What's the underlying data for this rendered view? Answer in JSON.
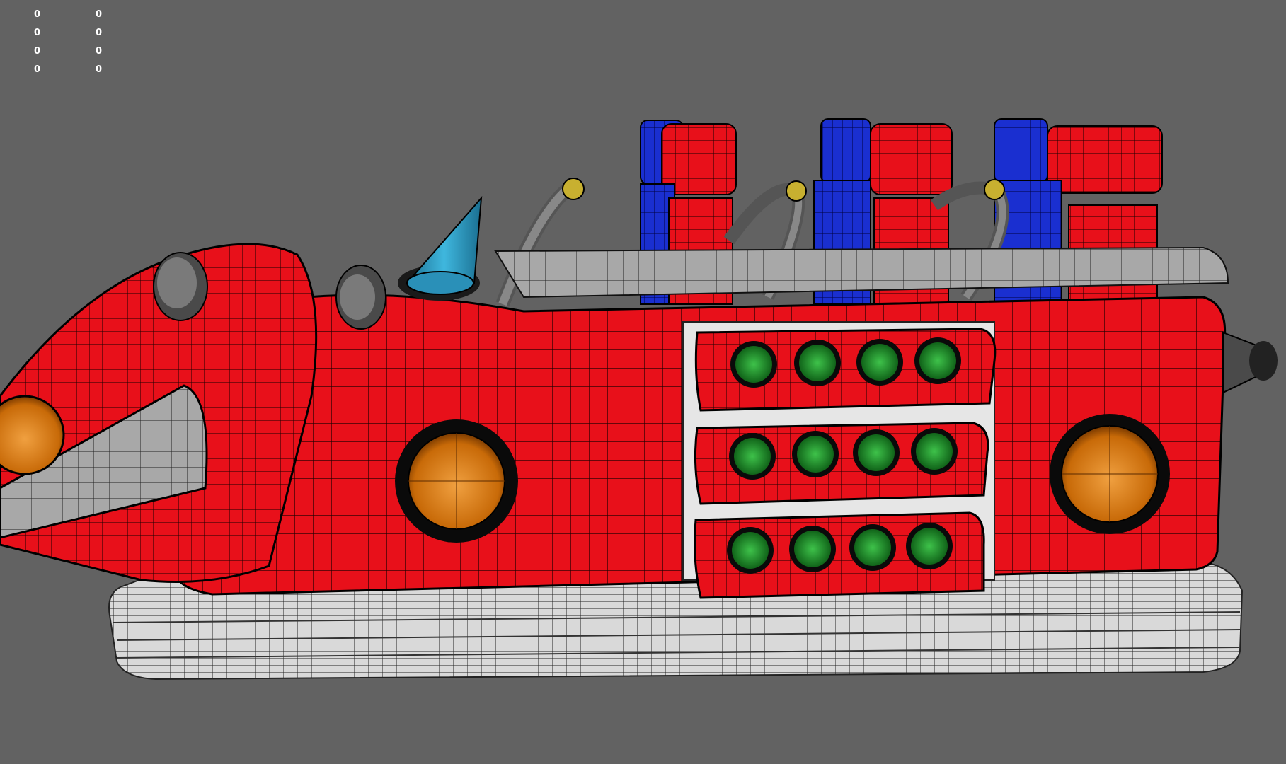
{
  "viewport": {
    "background_color": "#626262",
    "stats": [
      {
        "left": "0",
        "right": "0"
      },
      {
        "left": "0",
        "right": "0"
      },
      {
        "left": "0",
        "right": "0"
      },
      {
        "left": "0",
        "right": "0"
      }
    ]
  },
  "model": {
    "body_color": "#e8101a",
    "seat_back_color": "#1a2fd0",
    "wireframe_color": "#000000",
    "base_color": "#d0d0d0",
    "lamp_color": "#e07f10",
    "light_color": "#1f9a2a",
    "horn_color": "#2aa0c8"
  }
}
